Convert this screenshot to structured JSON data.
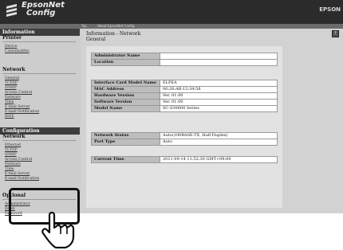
{
  "header": {
    "brand_line1": "EpsonNet",
    "brand_line2": "Config",
    "vendor": "EPSON",
    "subnav": [
      "Top",
      "About EpsonNet Config"
    ]
  },
  "sidebar": {
    "information": {
      "header": "Information",
      "title": "Printer",
      "items": [
        "Device",
        "Consumables"
      ]
    },
    "network": {
      "title": "Network",
      "items": [
        "General",
        "TCP/IP",
        "SNMP",
        "Access Control",
        "Netware",
        "Time",
        "E-mail Server",
        "E-mail Notification",
        "IEEE"
      ]
    },
    "configuration": {
      "header": "Configuration",
      "title": "Network",
      "items": [
        "Ethernet",
        "TCP/IP",
        "SNMP",
        "Access Control",
        "Netware",
        "Time",
        "E-mail Server",
        "E-mail Notification"
      ]
    },
    "optional": {
      "title": "Optional",
      "items": [
        "Administrator",
        "Reset",
        "Password"
      ]
    }
  },
  "main": {
    "title": "Information - Network",
    "subtitle": "General",
    "groups": [
      [
        {
          "label": "Administrator Name",
          "value": ""
        },
        {
          "label": "Location",
          "value": ""
        }
      ],
      [
        {
          "label": "Interface Card Model Name",
          "value": "ELPEA"
        },
        {
          "label": "MAC Address",
          "value": "00:26:AB:12:34:56"
        },
        {
          "label": "Hardware Version",
          "value": "Ver. 01.00"
        },
        {
          "label": "Software Version",
          "value": "Ver. 01.00"
        },
        {
          "label": "Model Name",
          "value": "SC-S30600 Series"
        }
      ],
      [
        {
          "label": "Network Status",
          "value": "Auto(100BASE-TX, Half Duplex)"
        },
        {
          "label": "Port Type",
          "value": "Auto"
        }
      ],
      [
        {
          "label": "Current Time",
          "value": "2011-09-14 11:52:30 GMT+09:00"
        }
      ]
    ]
  },
  "icons": {
    "logo": "epson-logo-icon",
    "help": "help-icon",
    "pointer": "hand-pointer-icon"
  },
  "colors": {
    "topbar": "#2b2b2b",
    "section_header": "#3d3d3d",
    "label_cell": "#bdbdbd"
  }
}
